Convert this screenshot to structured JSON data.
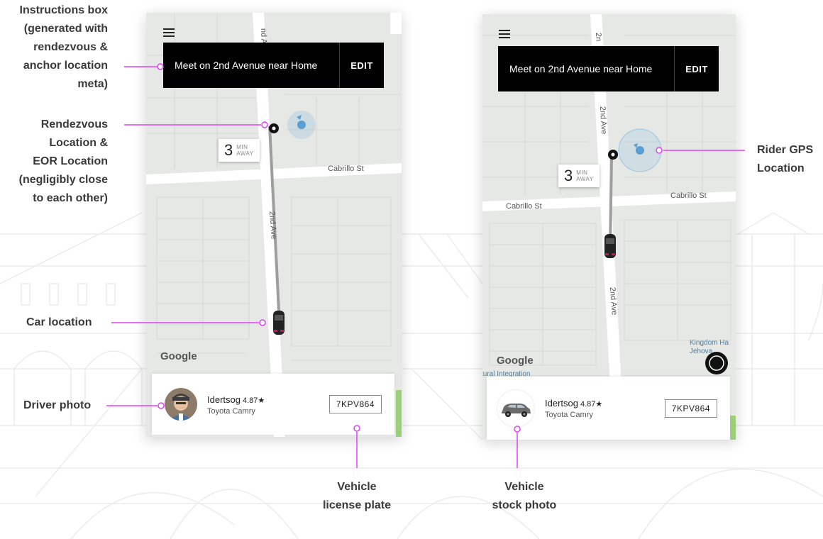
{
  "callouts": {
    "instructions": [
      "Instructions box",
      "(generated with",
      "rendezvous &",
      "anchor location",
      "meta)"
    ],
    "rendezvous": [
      "Rendezvous",
      "Location &",
      "EOR Location",
      "(negligibly close",
      "to each other)"
    ],
    "car": [
      "Car location"
    ],
    "driver": [
      "Driver photo"
    ],
    "plate": [
      "Vehicle",
      "license plate"
    ],
    "stock": [
      "Vehicle",
      "stock photo"
    ],
    "gps": [
      "Rider GPS",
      "Location"
    ]
  },
  "left_phone": {
    "instruction": "Meet on 2nd Avenue near Home",
    "edit": "EDIT",
    "eta_number": "3",
    "eta_units": [
      "MIN",
      "AWAY"
    ],
    "streets": {
      "cabrillo": "Cabrillo St",
      "second_ave": "2nd Ave",
      "top_fragment": "nd Ave"
    },
    "google": "Google",
    "driver": {
      "name": "Idertsog",
      "rating": "4.87★",
      "car": "Toyota Camry",
      "plate": "7KPV864"
    }
  },
  "right_phone": {
    "instruction": "Meet on 2nd Avenue near Home",
    "edit": "EDIT",
    "eta_number": "3",
    "eta_units": [
      "MIN",
      "AWAY"
    ],
    "streets": {
      "cabrillo_left": "Cabrillo St",
      "cabrillo_right": "Cabrillo St",
      "second_ave_upper": "2nd Ave",
      "second_ave_lower": "2nd Ave",
      "top_fragment": "2n"
    },
    "poi": [
      "Kingdom Ha",
      "Jehova",
      "tural Integration"
    ],
    "google": "Google",
    "driver": {
      "name": "Idertsog",
      "rating": "4.87★",
      "car": "Toyota Camry",
      "plate": "7KPV864"
    }
  },
  "colors": {
    "callout_line": "#e040fb",
    "map_bg": "#e6e8e6",
    "road": "#ffffff",
    "route": "#9e9e9e",
    "gps": "#5a9fd4",
    "green": "#9ccf7a"
  }
}
